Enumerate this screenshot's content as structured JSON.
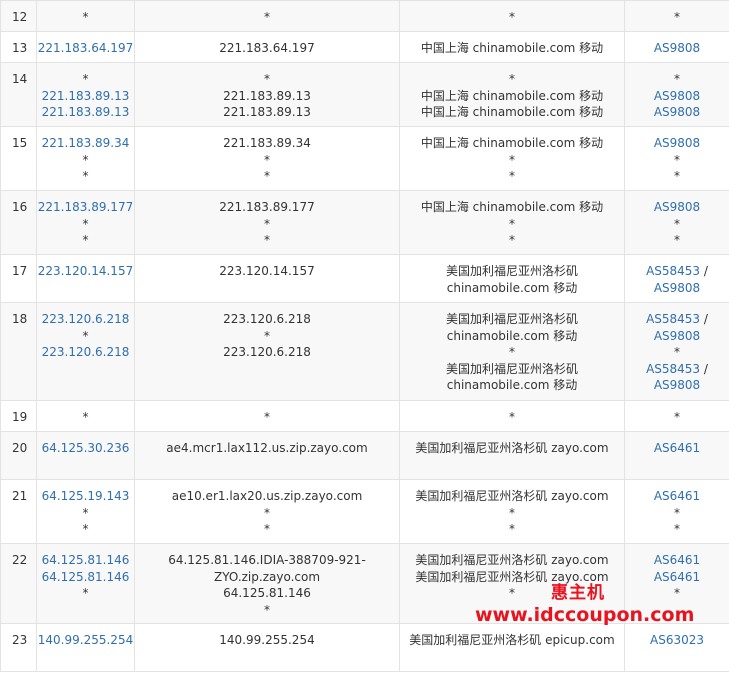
{
  "rows": [
    {
      "hop": "12",
      "ips": [
        "*"
      ],
      "hosts": [
        "*"
      ],
      "locs": [
        "*"
      ],
      "asns": [
        [
          "*"
        ]
      ],
      "h": 31
    },
    {
      "hop": "13",
      "ips": [
        "221.183.64.197"
      ],
      "hosts": [
        "221.183.64.197"
      ],
      "locs": [
        "中国上海 chinamobile.com 移动"
      ],
      "asns": [
        [
          "AS9808"
        ]
      ],
      "h": 31
    },
    {
      "hop": "14",
      "ips": [
        "*",
        "221.183.89.13",
        "221.183.89.13"
      ],
      "hosts": [
        "*",
        "221.183.89.13",
        "221.183.89.13"
      ],
      "locs": [
        "*",
        "中国上海 chinamobile.com 移动",
        "中国上海 chinamobile.com 移动"
      ],
      "asns": [
        [
          "*"
        ],
        [
          "AS9808"
        ],
        [
          "AS9808"
        ]
      ],
      "h": 64
    },
    {
      "hop": "15",
      "ips": [
        "221.183.89.34",
        "*",
        "*"
      ],
      "hosts": [
        "221.183.89.34",
        "*",
        "*"
      ],
      "locs": [
        "中国上海 chinamobile.com 移动",
        "*",
        "*"
      ],
      "asns": [
        [
          "AS9808"
        ],
        [
          "*"
        ],
        [
          "*"
        ]
      ],
      "h": 64
    },
    {
      "hop": "16",
      "ips": [
        "221.183.89.177",
        "*",
        "*"
      ],
      "hosts": [
        "221.183.89.177",
        "*",
        "*"
      ],
      "locs": [
        "中国上海 chinamobile.com 移动",
        "*",
        "*"
      ],
      "asns": [
        [
          "AS9808"
        ],
        [
          "*"
        ],
        [
          "*"
        ]
      ],
      "h": 64
    },
    {
      "hop": "17",
      "ips": [
        "223.120.14.157"
      ],
      "hosts": [
        "223.120.14.157"
      ],
      "locs": [
        "美国加利福尼亚州洛杉矶",
        "chinamobile.com 移动"
      ],
      "asns": [
        [
          "AS58453",
          "/"
        ],
        [
          "AS9808"
        ]
      ],
      "h": 48
    },
    {
      "hop": "18",
      "ips": [
        "223.120.6.218",
        "*",
        "223.120.6.218"
      ],
      "hosts": [
        "223.120.6.218",
        "*",
        "223.120.6.218"
      ],
      "locs": [
        "美国加利福尼亚州洛杉矶",
        "chinamobile.com 移动",
        "*",
        "美国加利福尼亚州洛杉矶",
        "chinamobile.com 移动"
      ],
      "asns": [
        [
          "AS58453",
          "/"
        ],
        [
          "AS9808"
        ],
        [
          "*"
        ],
        [
          "AS58453",
          "/"
        ],
        [
          "AS9808"
        ]
      ],
      "h": 98
    },
    {
      "hop": "19",
      "ips": [
        "*"
      ],
      "hosts": [
        "*"
      ],
      "locs": [
        "*"
      ],
      "asns": [
        [
          "*"
        ]
      ],
      "h": 31
    },
    {
      "hop": "20",
      "ips": [
        "64.125.30.236"
      ],
      "hosts": [
        "ae4.mcr1.lax112.us.zip.zayo.com"
      ],
      "locs": [
        "美国加利福尼亚州洛杉矶 zayo.com"
      ],
      "asns": [
        [
          "AS6461"
        ]
      ],
      "h": 48
    },
    {
      "hop": "21",
      "ips": [
        "64.125.19.143",
        "*",
        "*"
      ],
      "hosts": [
        "ae10.er1.lax20.us.zip.zayo.com",
        "*",
        "*"
      ],
      "locs": [
        "美国加利福尼亚州洛杉矶 zayo.com",
        "*",
        "*"
      ],
      "asns": [
        [
          "AS6461"
        ],
        [
          "*"
        ],
        [
          "*"
        ]
      ],
      "h": 64
    },
    {
      "hop": "22",
      "ips": [
        "64.125.81.146",
        "64.125.81.146",
        "*"
      ],
      "hosts": [
        "64.125.81.146.IDIA-388709-921-",
        "ZYO.zip.zayo.com",
        "64.125.81.146",
        "*"
      ],
      "locs": [
        "美国加利福尼亚州洛杉矶 zayo.com",
        "美国加利福尼亚州洛杉矶 zayo.com",
        "*"
      ],
      "asns": [
        [
          "AS6461"
        ],
        [
          "AS6461"
        ],
        [
          "*"
        ]
      ],
      "h": 80
    },
    {
      "hop": "23",
      "ips": [
        "140.99.255.254"
      ],
      "hosts": [
        "140.99.255.254"
      ],
      "locs": [
        "美国加利福尼亚州洛杉矶 epicup.com"
      ],
      "asns": [
        [
          "AS63023"
        ]
      ],
      "h": 48
    }
  ],
  "watermark": {
    "cn": "惠主机",
    "url": "www.idccoupon.com"
  }
}
